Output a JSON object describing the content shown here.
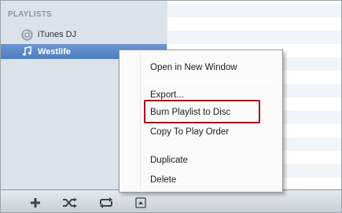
{
  "sidebar": {
    "section_header": "PLAYLISTS",
    "items": [
      {
        "label": "iTunes DJ",
        "icon": "itunes-dj-icon"
      },
      {
        "label": "Westlife",
        "icon": "playlist-note-icon",
        "selected": true
      }
    ]
  },
  "context_menu": {
    "items": [
      {
        "label": "Open in New Window"
      },
      {
        "label": "Export..."
      },
      {
        "label": "Burn Playlist to Disc",
        "highlighted": true
      },
      {
        "label": "Copy To Play Order"
      },
      {
        "label": "Duplicate"
      },
      {
        "label": "Delete"
      }
    ],
    "highlight_color": "#a3121a"
  },
  "toolbar": {
    "buttons": [
      {
        "icon": "plus-icon"
      },
      {
        "icon": "shuffle-icon"
      },
      {
        "icon": "repeat-icon"
      },
      {
        "icon": "artwork-toggle-icon"
      }
    ]
  },
  "colors": {
    "selection": "#5a88c8",
    "sidebar_bg": "#dbe2ea"
  }
}
